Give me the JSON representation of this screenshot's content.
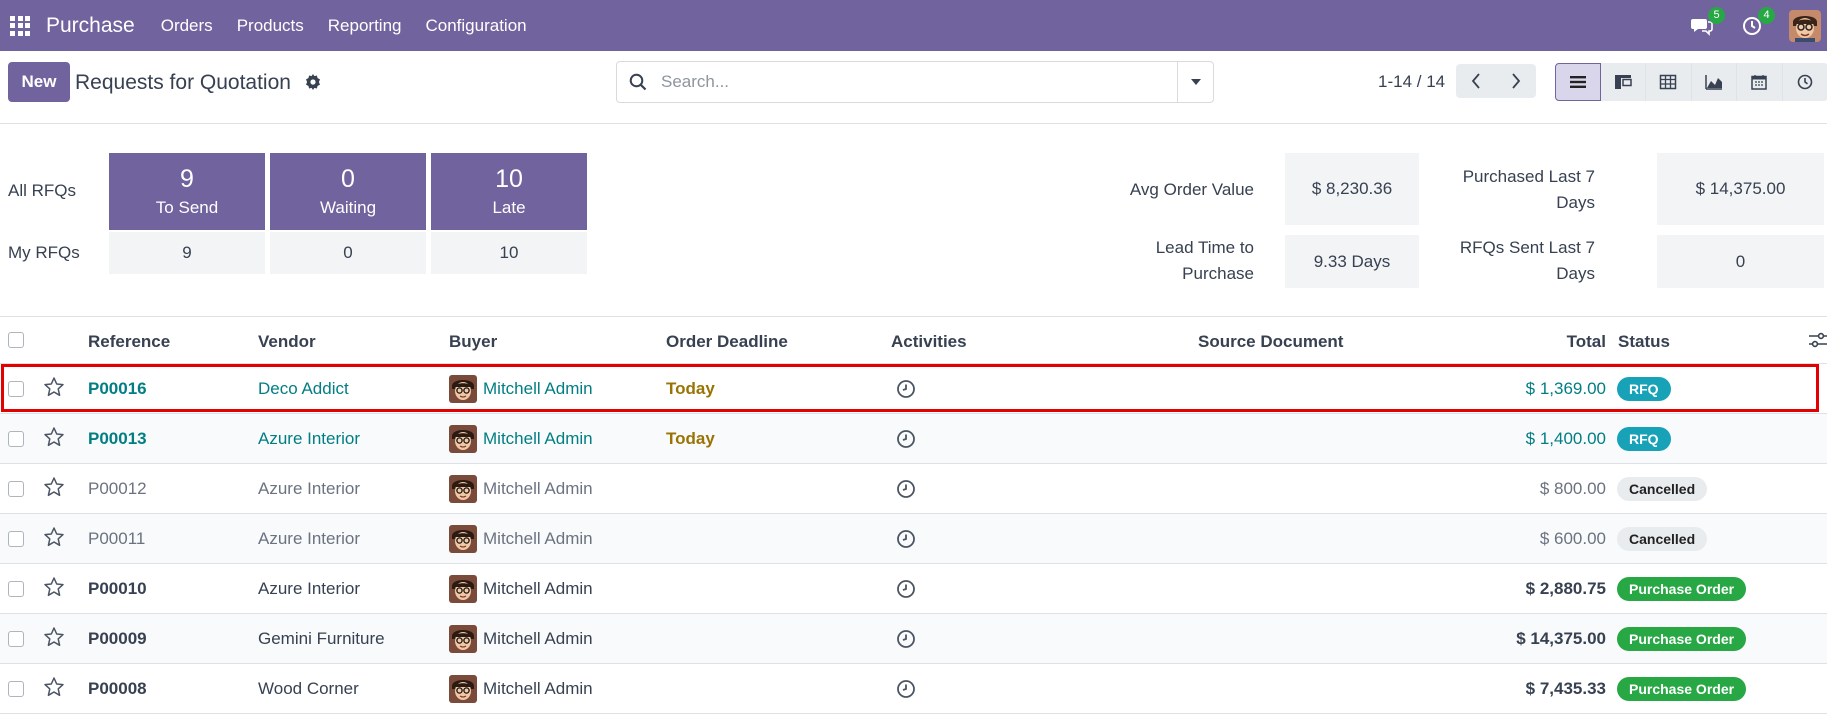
{
  "navbar": {
    "app_name": "Purchase",
    "menu": [
      "Orders",
      "Products",
      "Reporting",
      "Configuration"
    ],
    "messages_count": "5",
    "activities_count": "4"
  },
  "control_panel": {
    "new_label": "New",
    "title": "Requests for Quotation",
    "search_placeholder": "Search...",
    "pager": "1-14 / 14"
  },
  "dashboard": {
    "all_rfqs_label": "All RFQs",
    "my_rfqs_label": "My RFQs",
    "tiles": [
      {
        "count": "9",
        "label": "To Send",
        "mine": "9"
      },
      {
        "count": "0",
        "label": "Waiting",
        "mine": "0"
      },
      {
        "count": "10",
        "label": "Late",
        "mine": "10"
      }
    ],
    "kpis": {
      "avg_order_value_label": "Avg Order Value",
      "avg_order_value": "$ 8,230.36",
      "purchased_last_7_label_1": "Purchased Last 7",
      "purchased_last_7_label_2": "Days",
      "purchased_last_7": "$ 14,375.00",
      "lead_time_label_1": "Lead Time to",
      "lead_time_label_2": "Purchase",
      "lead_time": "9.33 Days",
      "rfqs_sent_label_1": "RFQs Sent Last 7",
      "rfqs_sent_label_2": "Days",
      "rfqs_sent": "0"
    }
  },
  "table": {
    "headers": {
      "reference": "Reference",
      "vendor": "Vendor",
      "buyer": "Buyer",
      "order_deadline": "Order Deadline",
      "activities": "Activities",
      "source_document": "Source Document",
      "total": "Total",
      "status": "Status"
    },
    "rows": [
      {
        "reference": "P00016",
        "vendor": "Deco Addict",
        "buyer": "Mitchell Admin",
        "deadline": "Today",
        "total": "$ 1,369.00",
        "status": "RFQ"
      },
      {
        "reference": "P00013",
        "vendor": "Azure Interior",
        "buyer": "Mitchell Admin",
        "deadline": "Today",
        "total": "$ 1,400.00",
        "status": "RFQ"
      },
      {
        "reference": "P00012",
        "vendor": "Azure Interior",
        "buyer": "Mitchell Admin",
        "deadline": "",
        "total": "$ 800.00",
        "status": "Cancelled"
      },
      {
        "reference": "P00011",
        "vendor": "Azure Interior",
        "buyer": "Mitchell Admin",
        "deadline": "",
        "total": "$ 600.00",
        "status": "Cancelled"
      },
      {
        "reference": "P00010",
        "vendor": "Azure Interior",
        "buyer": "Mitchell Admin",
        "deadline": "",
        "total": "$ 2,880.75",
        "status": "Purchase Order"
      },
      {
        "reference": "P00009",
        "vendor": "Gemini Furniture",
        "buyer": "Mitchell Admin",
        "deadline": "",
        "total": "$ 14,375.00",
        "status": "Purchase Order"
      },
      {
        "reference": "P00008",
        "vendor": "Wood Corner",
        "buyer": "Mitchell Admin",
        "deadline": "",
        "total": "$ 7,435.33",
        "status": "Purchase Order"
      }
    ]
  },
  "colors": {
    "brand": "#71639e",
    "link": "#017e84",
    "deadline": "#997404",
    "rfq_badge": "#17a2b8",
    "cancelled_badge": "#e9ecef",
    "purchase_badge": "#28a745",
    "highlight": "#e30000"
  }
}
